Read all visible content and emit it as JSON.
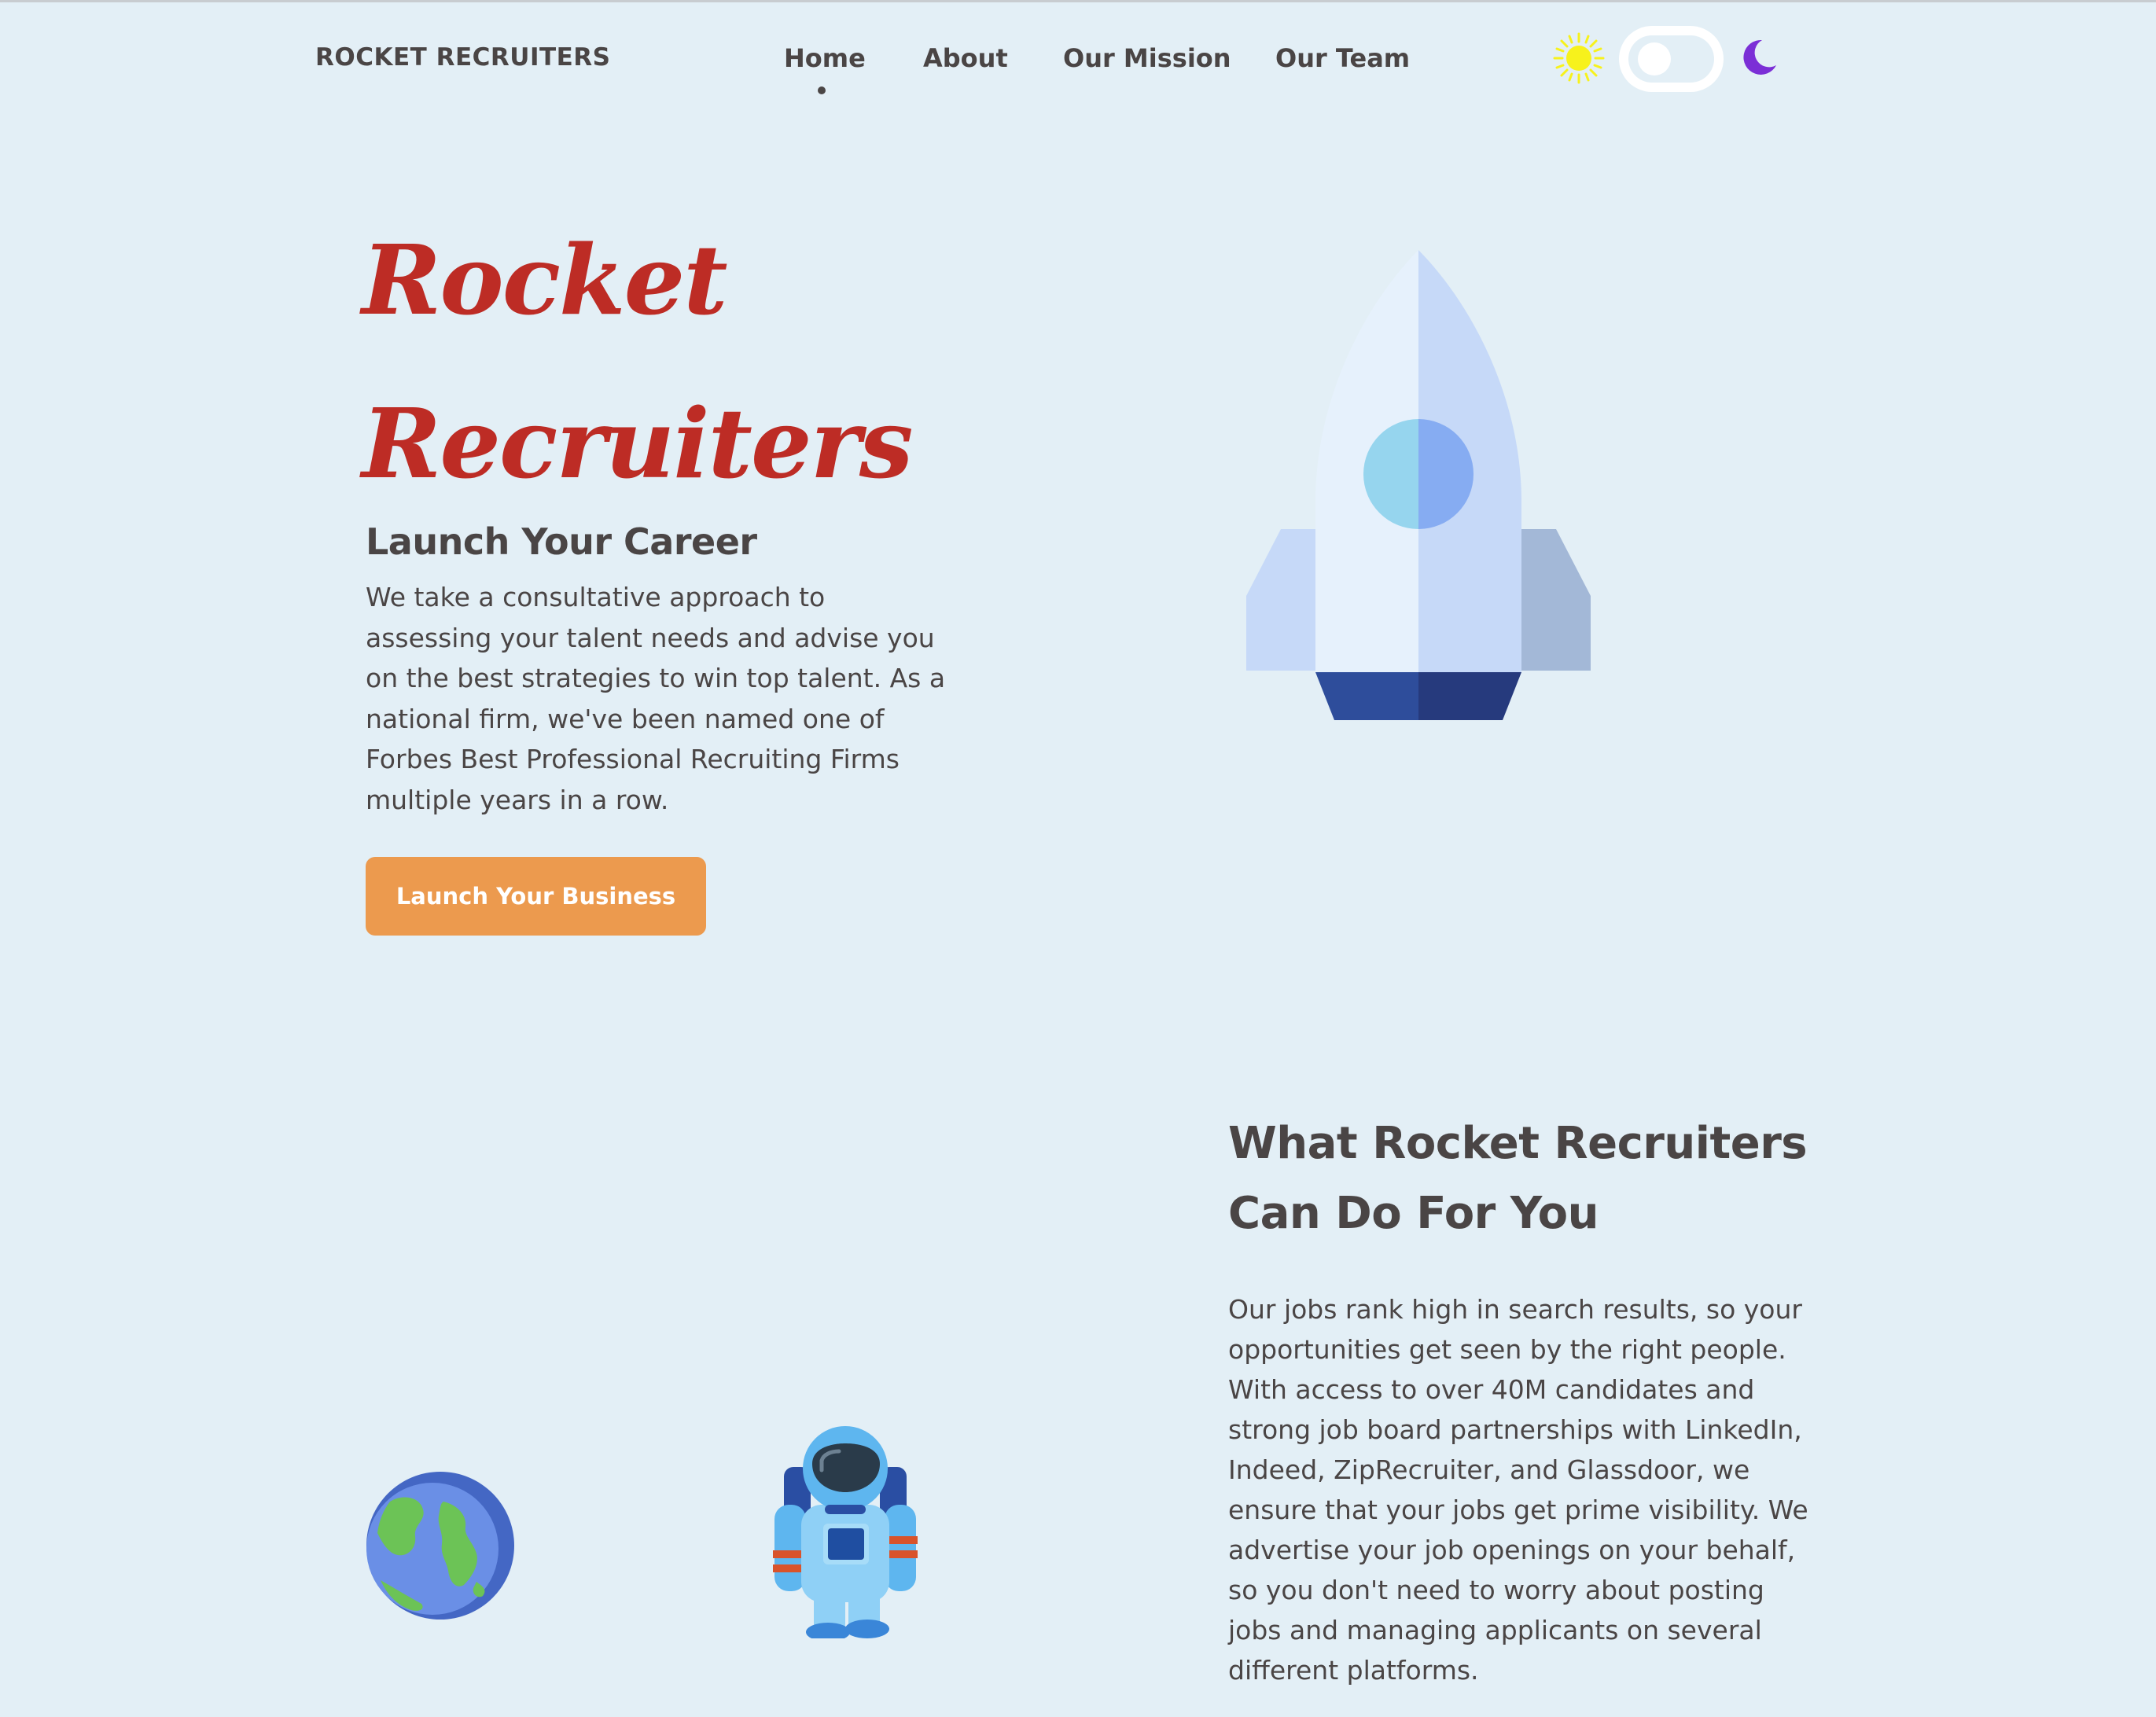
{
  "nav": {
    "brand": "ROCKET RECRUITERS",
    "links": [
      {
        "label": "Home",
        "active": true
      },
      {
        "label": "About",
        "active": false
      },
      {
        "label": "Our Mission",
        "active": false
      },
      {
        "label": "Our Team",
        "active": false
      }
    ],
    "theme_toggle": {
      "state": "light",
      "sun_icon": "sun-icon",
      "moon_icon": "moon-icon"
    }
  },
  "hero": {
    "title_line1": "Rocket",
    "title_line2": "Recruiters",
    "subtitle": "Launch Your Career",
    "description": "We take a consultative approach to assessing your talent needs and advise you on the best strategies to win top talent. As a national firm, we've been named one of Forbes Best Professional Recruiting Firms multiple years in a row.",
    "cta_label": "Launch Your Business",
    "illustration": "rocket-icon"
  },
  "services": {
    "title": "What Rocket Recruiters Can Do For You",
    "description": "Our jobs rank high in search results, so your opportunities get seen by the right people. With access to over 40M candidates and strong job board partnerships with LinkedIn, Indeed, ZipRecruiter, and Glassdoor, we ensure that your jobs get prime visibility. We advertise your job openings on your behalf, so you don't need to worry about posting jobs and managing applicants on several different platforms.",
    "illustrations": [
      "earth-icon",
      "astronaut-icon"
    ]
  },
  "colors": {
    "background": "#e3eff6",
    "text": "#4a4545",
    "accent_red": "#bd2c25",
    "cta_orange": "#ec9a4e",
    "moon_purple": "#7b2fd6",
    "sun_yellow": "#f7f21c"
  }
}
